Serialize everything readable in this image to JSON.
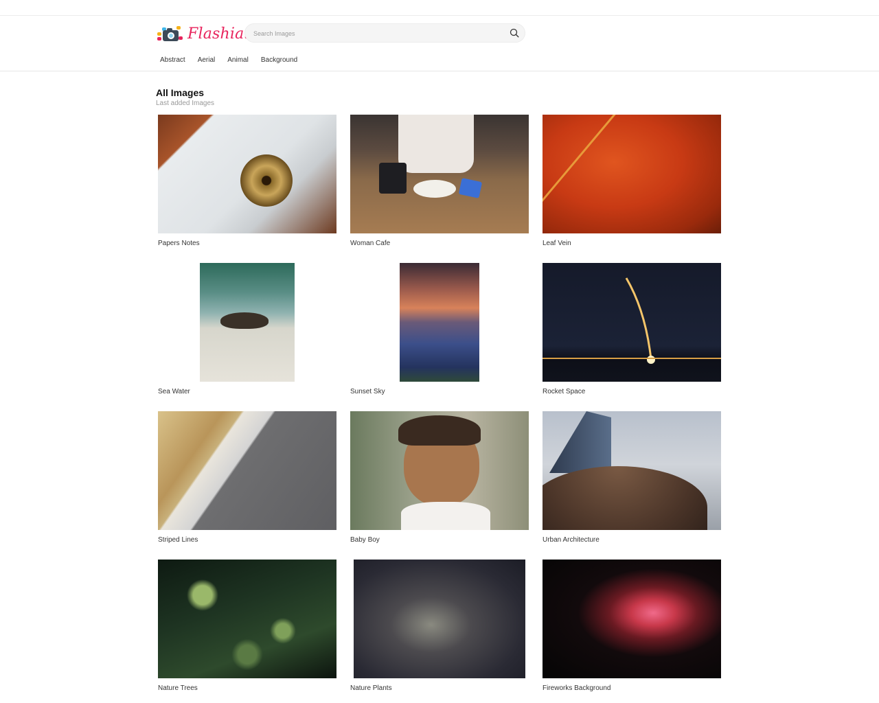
{
  "brand": {
    "name": "Flashiat"
  },
  "search": {
    "placeholder": "Search Images",
    "value": ""
  },
  "nav": [
    {
      "label": "Abstract"
    },
    {
      "label": "Aerial"
    },
    {
      "label": "Animal"
    },
    {
      "label": "Background"
    }
  ],
  "section": {
    "title": "All Images",
    "subtitle": "Last added Images"
  },
  "images": [
    {
      "title": "Papers Notes",
      "icon": "papers-notes-image"
    },
    {
      "title": "Woman Cafe",
      "icon": "woman-cafe-image"
    },
    {
      "title": "Leaf Vein",
      "icon": "leaf-vein-image"
    },
    {
      "title": "Sea Water",
      "icon": "sea-water-image"
    },
    {
      "title": "Sunset Sky",
      "icon": "sunset-sky-image"
    },
    {
      "title": "Rocket Space",
      "icon": "rocket-space-image"
    },
    {
      "title": "Striped Lines",
      "icon": "striped-lines-image"
    },
    {
      "title": "Baby Boy",
      "icon": "baby-boy-image"
    },
    {
      "title": "Urban Architecture",
      "icon": "urban-architecture-image"
    },
    {
      "title": "Nature Trees",
      "icon": "nature-trees-image"
    },
    {
      "title": "Nature Plants",
      "icon": "nature-plants-image"
    },
    {
      "title": "Fireworks Background",
      "icon": "fireworks-background-image"
    }
  ],
  "colors": {
    "brand": "#e8245d",
    "text": "#333333",
    "muted": "#999999"
  }
}
